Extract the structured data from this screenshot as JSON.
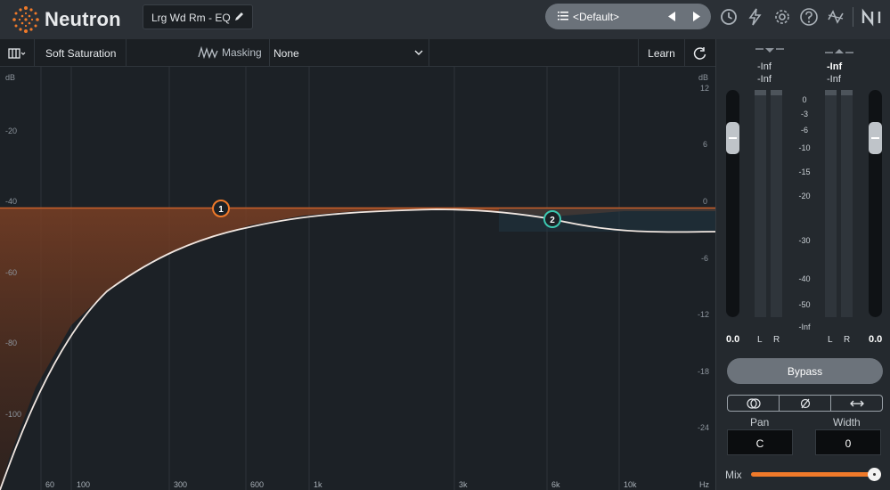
{
  "app": {
    "name": "Neutron"
  },
  "header": {
    "preset_name": "Lrg Wd Rm - EQ",
    "preset_selector": "<Default>"
  },
  "toolbar": {
    "saturation_label": "Soft Saturation",
    "masking_label": "Masking",
    "masking_select": "None",
    "learn_label": "Learn"
  },
  "eq": {
    "left_axis_title": "dB",
    "right_axis_title": "dB",
    "left_ticks": [
      "-20",
      "-40",
      "-60",
      "-80",
      "-100"
    ],
    "right_ticks": [
      "12",
      "6",
      "0",
      "-6",
      "-12",
      "-18",
      "-24"
    ],
    "freq_ticks": [
      "60",
      "100",
      "300",
      "600",
      "1k",
      "3k",
      "6k",
      "10k",
      "Hz"
    ],
    "nodes": [
      {
        "label": "1",
        "color": "#f07a2a"
      },
      {
        "label": "2",
        "color": "#3cc7b0"
      }
    ]
  },
  "meters": {
    "input_peak": "-Inf",
    "input_rms": "-Inf",
    "output_peak": "-Inf",
    "output_rms": "-Inf",
    "scale": [
      "0",
      "-3",
      "-6",
      "-10",
      "-15",
      "-20",
      "-30",
      "-40",
      "-50",
      "-Inf"
    ],
    "input_channels": [
      "L",
      "R"
    ],
    "output_channels": [
      "L",
      "R"
    ],
    "input_gain": "0.0",
    "output_gain": "0.0"
  },
  "controls": {
    "bypass_label": "Bypass",
    "pan_label": "Pan",
    "pan_value": "C",
    "width_label": "Width",
    "width_value": "0",
    "mix_label": "Mix",
    "mix_level": 1.0
  },
  "colors": {
    "accent": "#f07a2a",
    "node2": "#3cc7b0"
  }
}
